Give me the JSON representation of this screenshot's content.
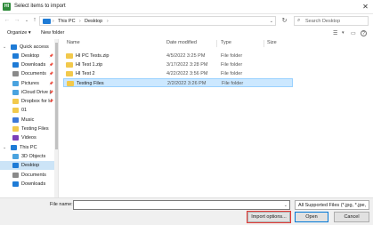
{
  "window": {
    "title": "Select items to import",
    "app_icon_text": "HI"
  },
  "nav": {
    "breadcrumb": [
      "This PC",
      "Desktop"
    ],
    "search_placeholder": "Search Desktop"
  },
  "toolbar": {
    "organize": "Organize ▾",
    "new_folder": "New folder"
  },
  "sidebar": {
    "items": [
      {
        "label": "Quick access",
        "icon": "star-icon",
        "color": "#1e7bd6",
        "pinned": false
      },
      {
        "label": "Desktop",
        "icon": "desktop-icon",
        "color": "#1e7bd6",
        "pinned": true
      },
      {
        "label": "Downloads",
        "icon": "downloads-icon",
        "color": "#1e7bd6",
        "pinned": true
      },
      {
        "label": "Documents",
        "icon": "documents-icon",
        "color": "#8a8a8a",
        "pinned": true
      },
      {
        "label": "Pictures",
        "icon": "pictures-icon",
        "color": "#4aa3df",
        "pinned": true
      },
      {
        "label": "iCloud Drive (",
        "icon": "cloud-icon",
        "color": "#4aa3df",
        "pinned": true
      },
      {
        "label": "Dropbox for H",
        "icon": "dropbox-icon",
        "color": "#f2c94c",
        "pinned": true
      },
      {
        "label": "01",
        "icon": "folder-icon",
        "color": "#f2c94c",
        "pinned": false
      },
      {
        "label": "Music",
        "icon": "music-icon",
        "color": "#3c78d8",
        "pinned": false
      },
      {
        "label": "Testing Files",
        "icon": "folder-icon",
        "color": "#f2c94c",
        "pinned": false
      },
      {
        "label": "Videos",
        "icon": "videos-icon",
        "color": "#7b3fb8",
        "pinned": false
      },
      {
        "label": "This PC",
        "icon": "pc-icon",
        "color": "#1e7bd6",
        "pinned": false
      },
      {
        "label": "3D Objects",
        "icon": "cube-icon",
        "color": "#4aa3df",
        "pinned": false
      },
      {
        "label": "Desktop",
        "icon": "desktop-icon",
        "color": "#1e7bd6",
        "pinned": false
      },
      {
        "label": "Documents",
        "icon": "documents-icon",
        "color": "#8a8a8a",
        "pinned": false
      },
      {
        "label": "Downloads",
        "icon": "downloads-icon",
        "color": "#1e7bd6",
        "pinned": false
      }
    ]
  },
  "columns": {
    "name": "Name",
    "date": "Date modified",
    "type": "Type",
    "size": "Size"
  },
  "files": [
    {
      "name": "HI PC Tests.zip",
      "date": "4/5/2022 3:25 PM",
      "type": "File folder",
      "size": ""
    },
    {
      "name": "HI Test 1.zip",
      "date": "3/17/2022 3:28 PM",
      "type": "File folder",
      "size": ""
    },
    {
      "name": "HI Test 2",
      "date": "4/22/2022 3:56 PM",
      "type": "File folder",
      "size": ""
    },
    {
      "name": "Testing Files",
      "date": "2/2/2022 3:26 PM",
      "type": "File folder",
      "size": ""
    }
  ],
  "footer": {
    "filename_label": "File name:",
    "filename_value": "",
    "filter": "All Supported Files (*.jpg, *.jpe,",
    "import_options": "Import options...",
    "open": "Open",
    "cancel": "Cancel"
  }
}
